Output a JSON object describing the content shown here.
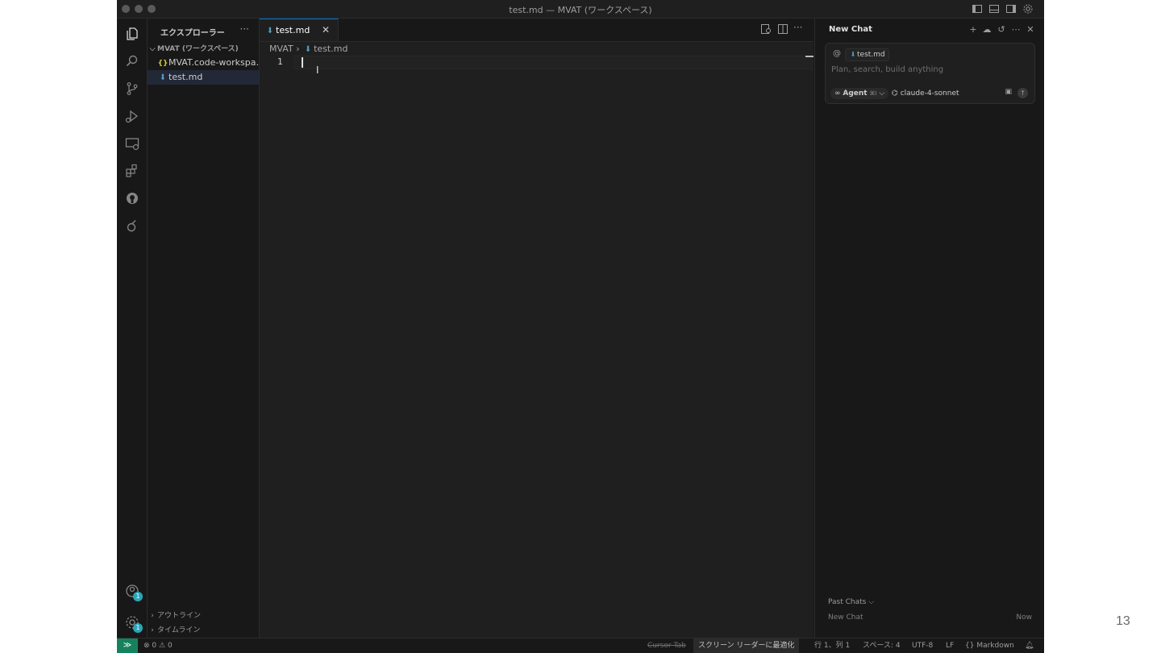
{
  "window": {
    "title": "test.md — MVAT (ワークスペース)"
  },
  "explorer": {
    "title": "エクスプローラー",
    "more": "···",
    "workspace_root": "MVAT (ワークスペース)",
    "files": [
      {
        "name": "MVAT.code-workspa…",
        "icon": "json-icon"
      },
      {
        "name": "test.md",
        "icon": "markdown-icon"
      }
    ],
    "sections": [
      "アウトライン",
      "タイムライン"
    ]
  },
  "activity": {
    "accounts_badge": "1",
    "settings_badge": "1"
  },
  "editor": {
    "tab_label": "test.md",
    "breadcrumb_root": "MVAT",
    "breadcrumb_file": "test.md",
    "line_number": "1"
  },
  "chat": {
    "title": "New Chat",
    "at_sign": "@",
    "context_file": "test.md",
    "placeholder": "Plan, search, build anything",
    "agent_label": "Agent",
    "agent_shortcut": "⌘I",
    "model": "claude-4-sonnet",
    "past_chats_label": "Past Chats",
    "past_chat_item": "New Chat",
    "past_chat_time": "Now"
  },
  "status": {
    "errors": "0",
    "warnings": "0",
    "cursor_tab": "Cursor Tab",
    "screen_reader": "スクリーン リーダーに最適化",
    "position": "行 1、列 1",
    "indent": "スペース: 4",
    "encoding": "UTF-8",
    "eol": "LF",
    "language": "Markdown"
  },
  "slide": {
    "page_number": "13"
  },
  "colors": {
    "accent": "#0078d4",
    "remote": "#16825d",
    "badge": "#2aa6b8",
    "markdown": "#519aba"
  }
}
